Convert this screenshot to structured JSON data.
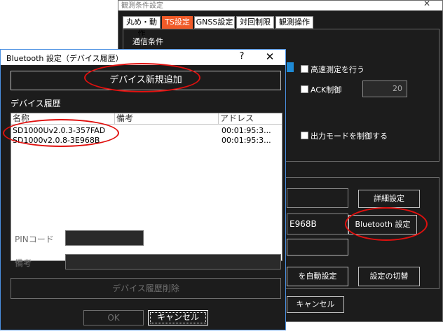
{
  "back_window": {
    "title": "観測条件設定",
    "close": "✕",
    "tabs": [
      {
        "label": "丸め・動作"
      },
      {
        "label": "TS設定",
        "active": true
      },
      {
        "label": "GNSS設定"
      },
      {
        "label": "対回制限"
      },
      {
        "label": "観測操作"
      }
    ],
    "group_label": "通信条件",
    "high_speed_label": "高速測定を行う",
    "ack_label": "ACK制御",
    "ack_value": "20",
    "output_mode_label": "出力モードを制御する",
    "detail_button": "詳細設定",
    "device_suffix": "E968B",
    "bluetooth_button": "Bluetooth 設定",
    "auto_set_button": "を自動設定",
    "switch_button": "設定の切替",
    "cancel_button": "キャンセル"
  },
  "dialog": {
    "title": "Bluetooth 設定（デバイス履歴）",
    "help": "?",
    "close": "✕",
    "add_device_button": "デバイス新規追加",
    "history_label": "デバイス履歴",
    "columns": {
      "name": "名称",
      "note": "備考",
      "address": "アドレス"
    },
    "rows": [
      {
        "name": "SD1000Uv2.0.3-357FAD",
        "note": "",
        "address": "00:01:95:3..."
      },
      {
        "name": "SD1000v2.0.8-3E968B",
        "note": "",
        "address": "00:01:95:3..."
      }
    ],
    "pin_label": "PINコード",
    "note_label": "備考",
    "delete_button": "デバイス履歴削除",
    "ok_button": "OK",
    "cancel_button": "キャンセル"
  },
  "colors": {
    "accent_tab": "#f05a28",
    "dark_bg": "#1c1c1c",
    "annotation_red": "#e0100e",
    "focus_blue": "#4a90e2"
  }
}
